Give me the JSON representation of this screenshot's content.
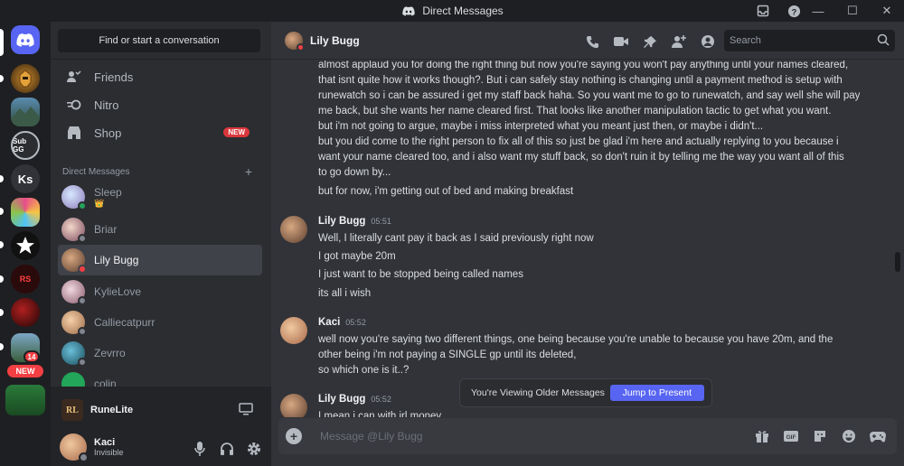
{
  "window": {
    "title": "Direct Messages"
  },
  "servers": {
    "items": [
      {
        "name": "Home",
        "label": ""
      },
      {
        "name": "Helmet server",
        "label": ""
      },
      {
        "name": "Mountain server",
        "label": ""
      },
      {
        "name": "Sub GG server",
        "label": "Sub GG"
      },
      {
        "name": "Ks server",
        "label": "Ks"
      },
      {
        "name": "Colorful server",
        "label": ""
      },
      {
        "name": "Star server",
        "label": ""
      },
      {
        "name": "RS Shopping server",
        "label": "RS"
      },
      {
        "name": "Red art server",
        "label": ""
      },
      {
        "name": "Fantasy server",
        "label": ""
      }
    ],
    "mention_count": "14",
    "new_label": "NEW"
  },
  "dm_sidebar": {
    "search_label": "Find or start a conversation",
    "nav": [
      {
        "label": "Friends"
      },
      {
        "label": "Nitro"
      },
      {
        "label": "Shop",
        "badge": "NEW"
      }
    ],
    "dm_header": "Direct Messages",
    "dms": [
      {
        "name": "Sleep",
        "status": "online",
        "sub": "👑"
      },
      {
        "name": "Briar",
        "status": "offline"
      },
      {
        "name": "Lily Bugg",
        "status": "dnd"
      },
      {
        "name": "KylieLove",
        "status": "offline"
      },
      {
        "name": "Calliecatpurr",
        "status": "offline"
      },
      {
        "name": "Zevrro",
        "status": "offline"
      },
      {
        "name": "colin",
        "status": "offline"
      }
    ]
  },
  "activity": {
    "name": "RuneLite"
  },
  "user": {
    "name": "Kaci",
    "status": "Invisible"
  },
  "chat": {
    "recipient": "Lily Bugg",
    "search_placeholder": "Search",
    "composer_placeholder": "Message @Lily Bugg",
    "older_banner": "You're Viewing Older Messages",
    "jump_label": "Jump to Present"
  },
  "messages": {
    "cont_lines": [
      "almost applaud you for doing the right thing but now you're saying you won't pay anything until your names cleared,",
      "that isnt quite how it works though?. But i can safely stay nothing is changing until a payment method is setup with",
      "runewatch so i can be assured i get my staff back haha. So you want me to go to runewatch, and say well she will pay",
      "me back, but she wants her name cleared first. That looks like another manipulation tactic to get what you want.",
      "but i'm not going to argue, maybe i miss interpreted what you meant just then, or maybe i didn't...",
      "but you did come to the right person to fix all of this so just be glad i'm here and actually replying to you because i",
      "want your name cleared too, and i also want my stuff back, so don't ruin it by telling me the way you want all of this",
      "to go down by...",
      "but for now, i'm getting out of bed and making breakfast"
    ],
    "g1": {
      "author": "Lily Bugg",
      "time": "05:51",
      "lines": [
        "Well, I literally cant pay it back as I said previously right now",
        "I got maybe 20m",
        "I just want to be stopped being called names",
        "its all i wish"
      ]
    },
    "g2": {
      "author": "Kaci",
      "time": "05:52",
      "lines": [
        "well now you're saying two different things, one being because you're unable to because you have 20m, and the",
        "other being i'm not paying a SINGLE gp until its deleted,",
        "so which one is it..?"
      ]
    },
    "g3": {
      "author": "Lily Bugg",
      "time": "05:52",
      "lines": [
        "I mean i can with irl money"
      ]
    }
  }
}
